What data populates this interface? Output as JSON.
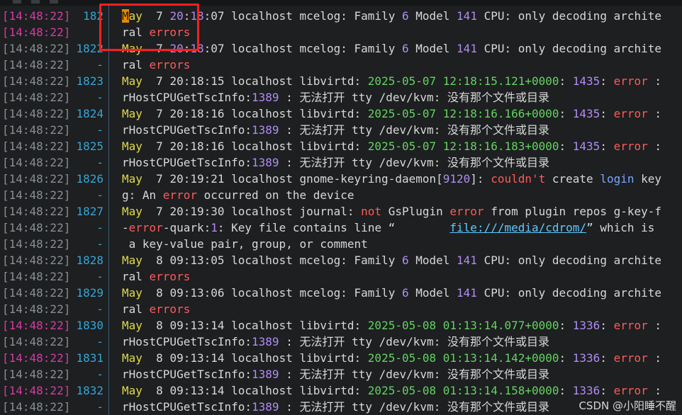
{
  "watermark": "CSDN @小阳睡不醒",
  "rows": [
    {
      "ts": "[14:48:22]",
      "ln": "182",
      "hl": true
    },
    {
      "ts": "[14:48:22]",
      "ln": "",
      "hl": true
    },
    {
      "ts": "[14:48:22]",
      "ln": "1822"
    },
    {
      "ts": "[14:48:22]",
      "ln": "-"
    },
    {
      "ts": "[14:48:22]",
      "ln": "1823"
    },
    {
      "ts": "[14:48:22]",
      "ln": "-"
    },
    {
      "ts": "[14:48:22]",
      "ln": "1824"
    },
    {
      "ts": "[14:48:22]",
      "ln": "-"
    },
    {
      "ts": "[14:48:22]",
      "ln": "1825"
    },
    {
      "ts": "[14:48:22]",
      "ln": "-"
    },
    {
      "ts": "[14:48:22]",
      "ln": "1826"
    },
    {
      "ts": "[14:48:22]",
      "ln": "-"
    },
    {
      "ts": "[14:48:22]",
      "ln": "1827"
    },
    {
      "ts": "[14:48:22]",
      "ln": "-"
    },
    {
      "ts": "[14:48:22]",
      "ln": "-"
    },
    {
      "ts": "[14:48:22]",
      "ln": "1828"
    },
    {
      "ts": "[14:48:22]",
      "ln": "-"
    },
    {
      "ts": "[14:48:22]",
      "ln": "1829"
    },
    {
      "ts": "[14:48:22]",
      "ln": "-"
    },
    {
      "ts": "[14:48:22]",
      "ln": "1830",
      "hl": true
    },
    {
      "ts": "[14:48:22]",
      "ln": "-"
    },
    {
      "ts": "[14:48:22]",
      "ln": "1831",
      "hl": true
    },
    {
      "ts": "[14:48:22]",
      "ln": "-"
    },
    {
      "ts": "[14:48:22]",
      "ln": "1832",
      "hl": true
    },
    {
      "ts": "[14:48:22]",
      "ln": "-"
    }
  ],
  "lines": [
    [
      [
        "M",
        "cursor"
      ],
      [
        "ay",
        "mon"
      ],
      [
        "  7 ",
        "plain"
      ],
      [
        "20",
        "num"
      ],
      [
        ":",
        "plain"
      ],
      [
        "18",
        "num"
      ],
      [
        ":07 localhost mcelog: Family ",
        "plain"
      ],
      [
        "6",
        "num"
      ],
      [
        " Model ",
        "plain"
      ],
      [
        "141",
        "num"
      ],
      [
        " CPU: only decoding archite",
        "plain"
      ]
    ],
    [
      [
        "ral ",
        "plain"
      ],
      [
        "errors",
        "err"
      ]
    ],
    [
      [
        "May",
        "mon"
      ],
      [
        "  7 ",
        "plain"
      ],
      [
        "20",
        "num"
      ],
      [
        ":",
        "plain"
      ],
      [
        "18",
        "num"
      ],
      [
        ":07 localhost mcelog: Family ",
        "plain"
      ],
      [
        "6",
        "num"
      ],
      [
        " Model ",
        "plain"
      ],
      [
        "141",
        "num"
      ],
      [
        " CPU: only decoding archite",
        "plain"
      ]
    ],
    [
      [
        "ral ",
        "plain"
      ],
      [
        "errors",
        "err"
      ]
    ],
    [
      [
        "May",
        "mon"
      ],
      [
        "  7 20:18:15 localhost libvirtd: ",
        "plain"
      ],
      [
        "2025-05-07 12:18:15.121+0000",
        "grn"
      ],
      [
        ": ",
        "plain"
      ],
      [
        "1435",
        "num"
      ],
      [
        ": ",
        "plain"
      ],
      [
        "error",
        "err"
      ],
      [
        " :",
        "plain"
      ]
    ],
    [
      [
        "rHostCPUGetTscInfo:",
        "plain"
      ],
      [
        "1389",
        "num"
      ],
      [
        " : 无法打开 tty /dev/kvm: 没有那个文件或目录",
        "plain"
      ]
    ],
    [
      [
        "May",
        "mon"
      ],
      [
        "  7 20:18:16 localhost libvirtd: ",
        "plain"
      ],
      [
        "2025-05-07 12:18:16.166+0000",
        "grn"
      ],
      [
        ": ",
        "plain"
      ],
      [
        "1435",
        "num"
      ],
      [
        ": ",
        "plain"
      ],
      [
        "error",
        "err"
      ],
      [
        " :",
        "plain"
      ]
    ],
    [
      [
        "rHostCPUGetTscInfo:",
        "plain"
      ],
      [
        "1389",
        "num"
      ],
      [
        " : 无法打开 tty /dev/kvm: 没有那个文件或目录",
        "plain"
      ]
    ],
    [
      [
        "May",
        "mon"
      ],
      [
        "  7 20:18:16 localhost libvirtd: ",
        "plain"
      ],
      [
        "2025-05-07 12:18:16.183+0000",
        "grn"
      ],
      [
        ": ",
        "plain"
      ],
      [
        "1435",
        "num"
      ],
      [
        ": ",
        "plain"
      ],
      [
        "error",
        "err"
      ],
      [
        " :",
        "plain"
      ]
    ],
    [
      [
        "rHostCPUGetTscInfo:",
        "plain"
      ],
      [
        "1389",
        "num"
      ],
      [
        " : 无法打开 tty /dev/kvm: 没有那个文件或目录",
        "plain"
      ]
    ],
    [
      [
        "May",
        "mon"
      ],
      [
        "  7 20:19:21 localhost gnome-keyring-daemon[",
        "plain"
      ],
      [
        "9120",
        "num"
      ],
      [
        "]: ",
        "plain"
      ],
      [
        "couldn't",
        "err"
      ],
      [
        " create ",
        "plain"
      ],
      [
        "login",
        "blu"
      ],
      [
        " key",
        "plain"
      ]
    ],
    [
      [
        "g: An ",
        "plain"
      ],
      [
        "error",
        "err"
      ],
      [
        " occurred on the device",
        "plain"
      ]
    ],
    [
      [
        "May",
        "mon"
      ],
      [
        "  7 20:19:30 localhost journal: ",
        "plain"
      ],
      [
        "not",
        "err"
      ],
      [
        " GsPlugin ",
        "plain"
      ],
      [
        "error",
        "err"
      ],
      [
        " from plugin repos g-key-f",
        "plain"
      ]
    ],
    [
      [
        "-",
        "plain"
      ],
      [
        "error",
        "err"
      ],
      [
        "-quark:",
        "plain"
      ],
      [
        "1",
        "num"
      ],
      [
        ": Key file contains line “        ",
        "plain"
      ],
      [
        "file:///media/cdrom/",
        "url"
      ],
      [
        "” which is",
        "plain"
      ]
    ],
    [
      [
        " a key-value pair, group, or comment",
        "plain"
      ]
    ],
    [
      [
        "May",
        "mon"
      ],
      [
        "  8 09:13:05 localhost mcelog: Family ",
        "plain"
      ],
      [
        "6",
        "num"
      ],
      [
        " Model ",
        "plain"
      ],
      [
        "141",
        "num"
      ],
      [
        " CPU: only decoding archite",
        "plain"
      ]
    ],
    [
      [
        "ral ",
        "plain"
      ],
      [
        "errors",
        "err"
      ]
    ],
    [
      [
        "May",
        "mon"
      ],
      [
        "  8 09:13:06 localhost mcelog: Family ",
        "plain"
      ],
      [
        "6",
        "num"
      ],
      [
        " Model ",
        "plain"
      ],
      [
        "141",
        "num"
      ],
      [
        " CPU: only decoding archite",
        "plain"
      ]
    ],
    [
      [
        "ral ",
        "plain"
      ],
      [
        "errors",
        "err"
      ]
    ],
    [
      [
        "May",
        "mon"
      ],
      [
        "  8 09:13:14 localhost libvirtd: ",
        "plain"
      ],
      [
        "2025-05-08 01:13:14.077+0000",
        "grn"
      ],
      [
        ": ",
        "plain"
      ],
      [
        "1336",
        "num"
      ],
      [
        ": ",
        "plain"
      ],
      [
        "error",
        "err"
      ],
      [
        " :",
        "plain"
      ]
    ],
    [
      [
        "rHostCPUGetTscInfo:",
        "plain"
      ],
      [
        "1389",
        "num"
      ],
      [
        " : 无法打开 tty /dev/kvm: 没有那个文件或目录",
        "plain"
      ]
    ],
    [
      [
        "May",
        "mon"
      ],
      [
        "  8 09:13:14 localhost libvirtd: ",
        "plain"
      ],
      [
        "2025-05-08 01:13:14.142+0000",
        "grn"
      ],
      [
        ": ",
        "plain"
      ],
      [
        "1336",
        "num"
      ],
      [
        ": ",
        "plain"
      ],
      [
        "error",
        "err"
      ],
      [
        " :",
        "plain"
      ]
    ],
    [
      [
        "rHostCPUGetTscInfo:",
        "plain"
      ],
      [
        "1389",
        "num"
      ],
      [
        " : 无法打开 tty /dev/kvm: 没有那个文件或目录",
        "plain"
      ]
    ],
    [
      [
        "May",
        "mon"
      ],
      [
        "  8 09:13:14 localhost libvirtd: ",
        "plain"
      ],
      [
        "2025-05-08 01:13:14.158+0000",
        "grn"
      ],
      [
        ": ",
        "plain"
      ],
      [
        "1336",
        "num"
      ],
      [
        ": ",
        "plain"
      ],
      [
        "error",
        "err"
      ],
      [
        " :",
        "plain"
      ]
    ],
    [
      [
        "rHostCPUGetTscInfo:",
        "plain"
      ],
      [
        "1389",
        "num"
      ],
      [
        " : 无法打开 tty /dev/kvm: 没有那个文件或目录",
        "plain"
      ]
    ]
  ]
}
